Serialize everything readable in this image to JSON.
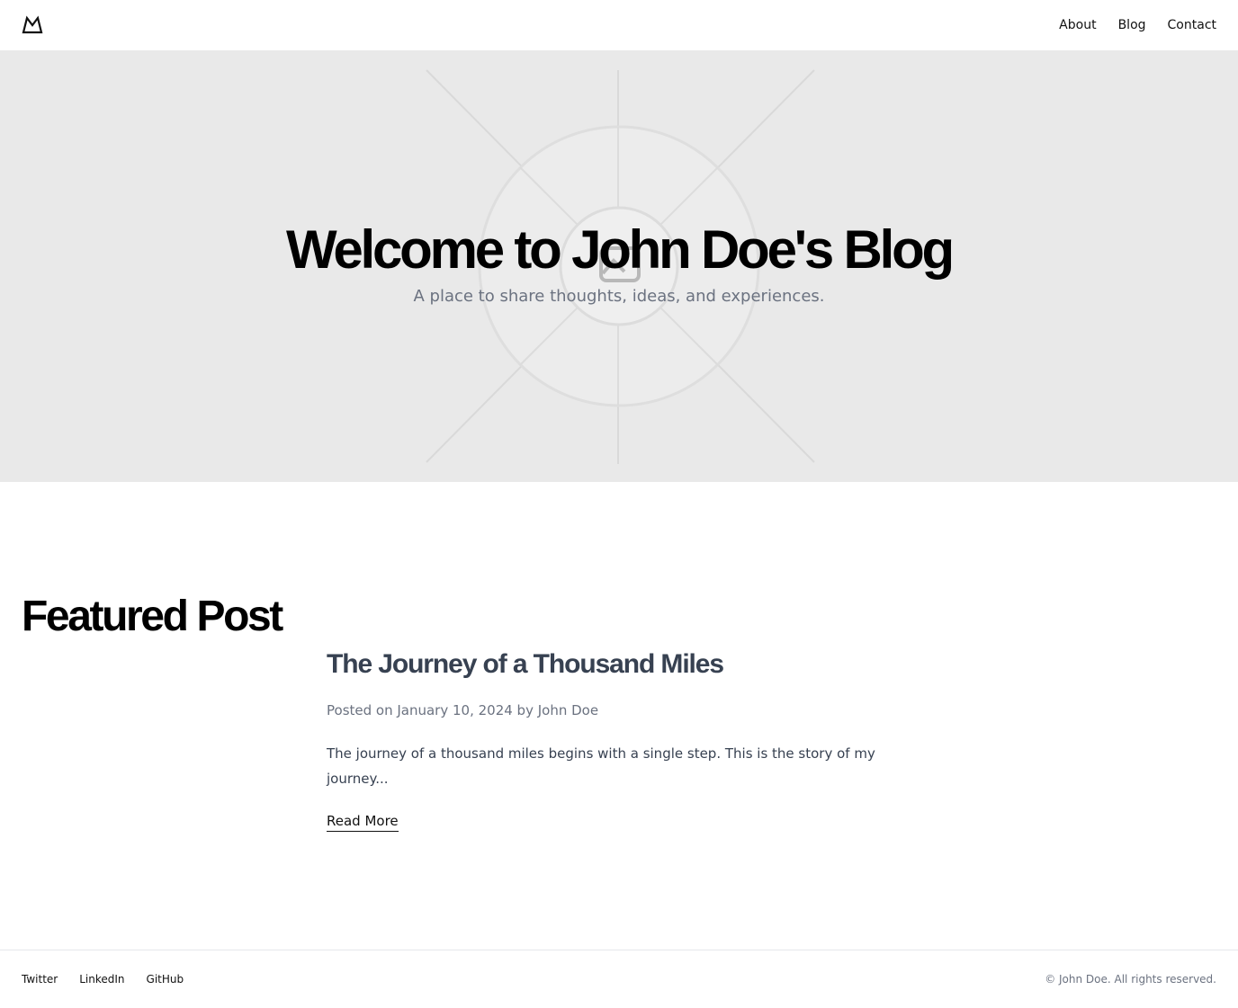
{
  "header": {
    "logo_icon": "mountain-logo-icon",
    "nav": [
      {
        "label": "About"
      },
      {
        "label": "Blog"
      },
      {
        "label": "Contact"
      }
    ]
  },
  "hero": {
    "title": "Welcome to John Doe's Blog",
    "subtitle": "A place to share thoughts, ideas, and experiences.",
    "background_icon": "image-placeholder-icon",
    "background_color": "#e9e9e9"
  },
  "featured": {
    "heading": "Featured Post",
    "post": {
      "title": "The Journey of a Thousand Miles",
      "meta": "Posted on January 10, 2024 by John Doe",
      "excerpt": "The journey of a thousand miles begins with a single step. This is the story of my journey...",
      "read_more": "Read More"
    }
  },
  "footer": {
    "links": [
      {
        "label": "Twitter"
      },
      {
        "label": "LinkedIn"
      },
      {
        "label": "GitHub"
      }
    ],
    "copyright": "© John Doe. All rights reserved."
  }
}
